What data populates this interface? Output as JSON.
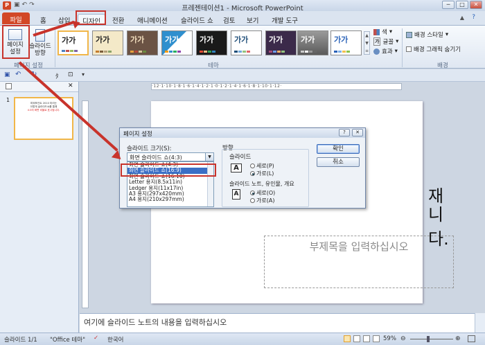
{
  "window": {
    "title": "프레젠테이션1 - Microsoft PowerPoint",
    "app_icon": "P",
    "controls": [
      "─",
      "□",
      "✕"
    ]
  },
  "tabs": [
    {
      "label": "파일"
    },
    {
      "label": "홈"
    },
    {
      "label": "삽입"
    },
    {
      "label": "디자인"
    },
    {
      "label": "전환"
    },
    {
      "label": "애니메이션"
    },
    {
      "label": "슬라이드 쇼"
    },
    {
      "label": "검토"
    },
    {
      "label": "보기"
    },
    {
      "label": "개발 도구"
    }
  ],
  "ribbon": {
    "page_setup_label": "페이지\n설정",
    "orientation_label": "슬라이드\n방향",
    "group_page_setup": "페이지 설정",
    "group_theme": "테마",
    "group_background": "배경",
    "theme_sample": "가가",
    "colors_label": "색",
    "fonts_label": "글꼴",
    "effects_label": "효과",
    "bg_style_label": "배경 스타일",
    "hide_bg_label": "배경 그래픽 숨기기",
    "theme_colors": [
      "#ffffff",
      "#f4e9c8",
      "#6b5344",
      "#2f8fce",
      "#1a1a1a",
      "#ffffff",
      "#3b2a4a",
      "#8a8a8a",
      "#ffffff"
    ]
  },
  "thumbnail": {
    "number": "1",
    "text_line1": "파워포인트 2010 미리는",
    "text_line2": "이렇게 슬라이드쇼를 통해",
    "text_line3": "4:3의 화면 비율로 표시됩니다."
  },
  "ruler": {
    "labels": "·12·1·10·1·8·1·6·1·4·1·2·1·0·1·2·1·4·1·6·1·8·1·10·1·12·"
  },
  "slide": {
    "title_fragment_1": "재",
    "title_fragment_2": "니다.",
    "subtitle_placeholder": "부제목을 입력하십시오"
  },
  "notes": {
    "placeholder": "여기에 슬라이드 노트의 내용을 입력하십시오"
  },
  "status": {
    "slide": "슬라이드 1/1",
    "theme": "\"Office 테마\"",
    "language": "한국어",
    "zoom": "59%"
  },
  "dialog": {
    "title": "페이지 설정",
    "help": "?",
    "close": "✕",
    "size_label": "슬라이드 크기(S):",
    "size_value": "화면 슬라이드 쇼(4:3)",
    "size_options": [
      "화면 슬라이드 쇼(4:3)",
      "화면 슬라이드 쇼(16:9)",
      "화면 슬라이드 쇼(16:10)",
      "Letter 용지(8.5x11in)",
      "Ledger 용지(11x17in)",
      "A3 용지(297x420mm)",
      "A4 용지(210x297mm)"
    ],
    "selected_index": 1,
    "orientation_label": "방향",
    "slide_label": "슬라이드",
    "portrait": "세로(P)",
    "landscape": "가로(L)",
    "notes_label": "슬라이드 노트, 유인물, 개요",
    "notes_portrait": "세로(O)",
    "notes_landscape": "가로(A)",
    "ok": "확인",
    "cancel": "취소"
  },
  "colors": {
    "file_tab": "#d24726",
    "highlight": "#c8332b",
    "selected_item": "#3a6fc6"
  }
}
